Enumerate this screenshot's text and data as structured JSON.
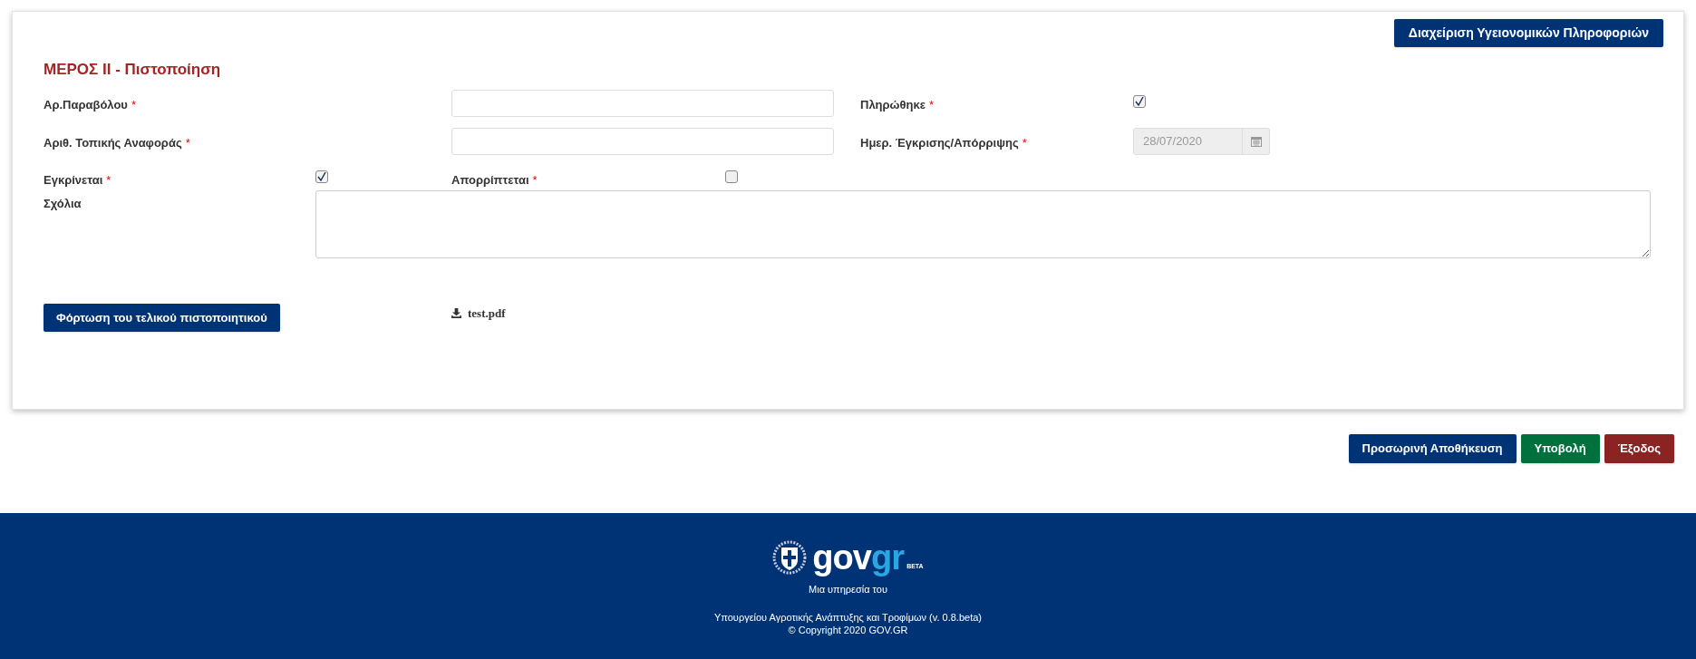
{
  "header_button": "Διαχείριση Υγειονομικών Πληροφοριών",
  "section_title": "ΜΕΡΟΣ II - Πιστοποίηση",
  "required_mark": "*",
  "rows": [
    {
      "fields": [
        {
          "kind": "text",
          "label": "Αρ.Παραβόλου",
          "required": true
        },
        {
          "kind": "checkbox",
          "label": "Πληρώθηκε",
          "required": true,
          "checked": true
        }
      ]
    },
    {
      "fields": [
        {
          "kind": "text",
          "label": "Αριθ. Τοπικής Αναφοράς",
          "required": true
        },
        {
          "kind": "date",
          "label": "Ημερ. Έγκρισης/Απόρριψης",
          "required": true,
          "value": "28/07/2020",
          "disabled": true
        }
      ]
    },
    {
      "fields": [
        {
          "kind": "checkbox",
          "label": "Εγκρίνεται",
          "required": true,
          "checked": true
        },
        {
          "kind": "checkbox",
          "label": "Απορρίπτεται",
          "required": true,
          "checked": false
        }
      ]
    }
  ],
  "comments": {
    "label": "Σχόλια"
  },
  "upload_button": "Φόρτωση του τελικού πιστοποιητικού",
  "attachment": "test.pdf",
  "actions": [
    {
      "kind": "primary",
      "label": "Προσωρινή Αποθήκευση"
    },
    {
      "kind": "success",
      "label": "Υποβολή"
    },
    {
      "kind": "danger",
      "label": "Έξοδος"
    }
  ],
  "footer": {
    "logo_gov": "gov",
    "logo_gr": "gr",
    "logo_badge": "BETA",
    "tagline": "Μια υπηρεσία του",
    "ministry": "Υπουργείου Αγροτικής Ανάπτυξης και Τροφίμων (v. 0.8.beta)",
    "copyright": "© Copyright 2020 GOV.GR"
  }
}
